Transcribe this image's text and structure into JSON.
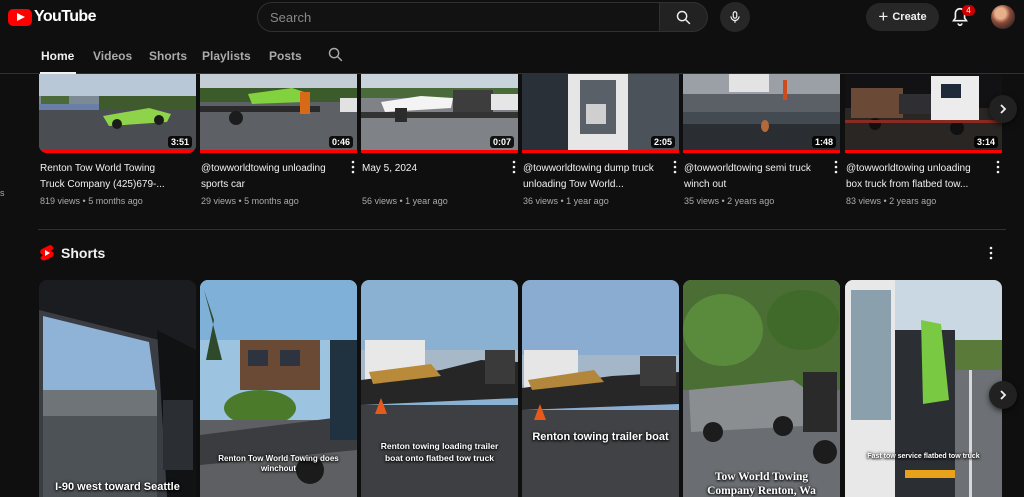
{
  "header": {
    "logo_text": "YouTube",
    "search_placeholder": "Search",
    "create_label": "Create",
    "notification_count": "4"
  },
  "tabs": [
    "Home",
    "Videos",
    "Shorts",
    "Playlists",
    "Posts"
  ],
  "active_tab": "Home",
  "videos": [
    {
      "title": "Renton Tow World Towing Truck Company (425)679-...",
      "views": "819 views",
      "age": "5 months ago",
      "duration": "3:51"
    },
    {
      "title": "@towworldtowing unloading sports car",
      "views": "29 views",
      "age": "5 months ago",
      "duration": "0:46"
    },
    {
      "title": "May 5, 2024",
      "views": "56 views",
      "age": "1 year ago",
      "duration": "0:07"
    },
    {
      "title": "@towworldtowing dump truck unloading Tow World...",
      "views": "36 views",
      "age": "1 year ago",
      "duration": "2:05"
    },
    {
      "title": "@towworldtowing semi truck winch out",
      "views": "35 views",
      "age": "2 years ago",
      "duration": "1:48"
    },
    {
      "title": "@towworldtowing unloading box truck from flatbed tow...",
      "views": "83 views",
      "age": "2 years ago",
      "duration": "3:14"
    }
  ],
  "shorts_section": {
    "title": "Shorts",
    "items": [
      {
        "caption": "I-90 west toward Seattle"
      },
      {
        "caption": "Renton Tow World Towing does winchout"
      },
      {
        "caption": "Renton towing loading trailer boat onto flatbed tow truck"
      },
      {
        "caption": "Renton towing trailer boat"
      },
      {
        "caption": "Tow World Towing Company Renton, Wa"
      },
      {
        "caption": "Fast tow service flatbed tow truck"
      }
    ]
  },
  "colors": {
    "background": "#0f0f0f",
    "accent_red": "#ff0000",
    "text": "#f1f1f1",
    "muted": "#aaaaaa"
  }
}
